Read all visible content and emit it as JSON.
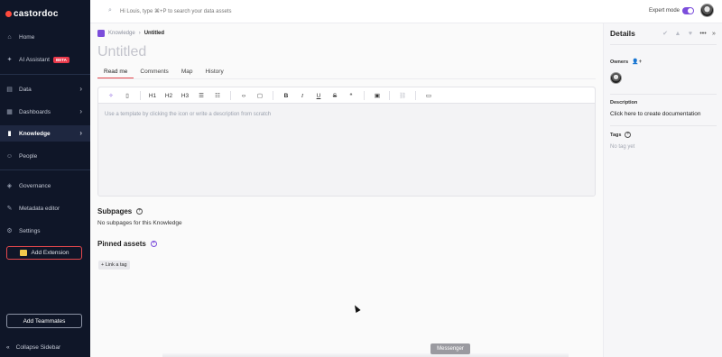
{
  "brand": {
    "name": "castordoc",
    "accent": "#ff4a3d"
  },
  "sidebar": {
    "items": [
      {
        "label": "Home",
        "icon": "home-icon"
      },
      {
        "label": "AI Assistant",
        "icon": "sparkle-icon",
        "badge": "BETA"
      },
      {
        "label": "Data",
        "icon": "database-icon"
      },
      {
        "label": "Dashboards",
        "icon": "dashboard-icon"
      },
      {
        "label": "Knowledge",
        "icon": "book-icon"
      },
      {
        "label": "People",
        "icon": "people-icon"
      },
      {
        "label": "Governance",
        "icon": "shield-icon"
      },
      {
        "label": "Metadata editor",
        "icon": "edit-icon"
      },
      {
        "label": "Settings",
        "icon": "gear-icon"
      }
    ],
    "add_extension": "Add Extension",
    "add_teammates": "Add Teammates",
    "collapse": "Collapse Sidebar"
  },
  "search": {
    "placeholder": "Hi Louis, type ⌘+P to search your data assets"
  },
  "header": {
    "expert_mode_label": "Expert mode",
    "expert_mode_on": true
  },
  "breadcrumb": {
    "parent": "Knowledge",
    "current": "Untitled"
  },
  "document": {
    "title": "Untitled",
    "tabs": [
      "Read me",
      "Comments",
      "Map",
      "History"
    ],
    "active_tab": "Read me",
    "toolbar": [
      "H1",
      "H2",
      "H3",
      "B",
      "I",
      "U",
      "S",
      "“"
    ],
    "placeholder": "Use a template by clicking the icon  or write a description from scratch"
  },
  "subpages": {
    "title": "Subpages",
    "empty_text": "No subpages for this Knowledge"
  },
  "pinned_assets": {
    "title": "Pinned assets",
    "link_tag": "+ Link a tag"
  },
  "messenger": "Messenger",
  "details": {
    "title": "Details",
    "owners_label": "Owners",
    "description_label": "Description",
    "description_cta": "Click here to create documentation",
    "tags_label": "Tags",
    "tags_empty": "No tag yet"
  }
}
